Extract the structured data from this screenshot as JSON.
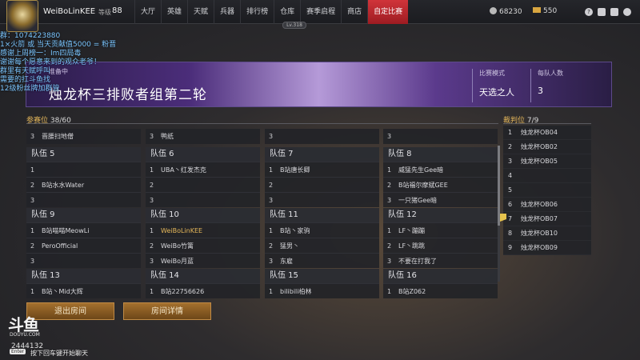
{
  "topbar": {
    "username": "WeiBoLinKEE",
    "level_label": "等级",
    "level_value": "88",
    "nav": [
      "大厅",
      "英雄",
      "天赋",
      "兵器",
      "排行榜",
      "仓库",
      "赛季启程",
      "商店",
      "自定比赛"
    ],
    "active_nav": "自定比赛",
    "coins": "68230",
    "gold": "550",
    "level_tag": "Lv.318"
  },
  "overlay": {
    "lines": [
      "群：1074223880",
      "1×火箭 或 当天贡献值5000 = 粉晋",
      "感谢上周榜一：Im四局毒",
      "谢谢每个愿意来到的观众老爷！",
      "群里有天赋呼叫",
      "需要的扛斗鱼找",
      "12级粉丝牌加群管"
    ]
  },
  "banner": {
    "subtitle": "准备中",
    "title": "烛龙杯三排败者组第二轮",
    "mode_label": "比赛模式",
    "mode_value": "天选之人",
    "size_label": "每队人数",
    "size_value": "3"
  },
  "participants": {
    "label": "参赛位",
    "count": "38/60"
  },
  "referees": {
    "label": "裁判位",
    "count": "7/9",
    "rows": [
      {
        "num": "1",
        "name": "烛龙杯OB04"
      },
      {
        "num": "2",
        "name": "烛龙杯OB02"
      },
      {
        "num": "3",
        "name": "烛龙杯OB05"
      },
      {
        "num": "4",
        "name": ""
      },
      {
        "num": "5",
        "name": ""
      },
      {
        "num": "6",
        "name": "烛龙杯OB06"
      },
      {
        "num": "7",
        "name": "烛龙杯OB07"
      },
      {
        "num": "8",
        "name": "烛龙杯OB10"
      },
      {
        "num": "9",
        "name": "烛龙杯OB09"
      }
    ]
  },
  "partial_row": [
    {
      "num": "3",
      "name": "晋腰扫地僧"
    },
    {
      "num": "3",
      "name": "鸭纸"
    },
    {
      "num": "3",
      "name": ""
    },
    {
      "num": "3",
      "name": ""
    }
  ],
  "teams": [
    {
      "title": "队伍 5",
      "players": [
        {
          "num": "1",
          "name": ""
        },
        {
          "num": "2",
          "name": "B站水水Water"
        },
        {
          "num": "3",
          "name": ""
        }
      ]
    },
    {
      "title": "队伍 6",
      "players": [
        {
          "num": "1",
          "name": "UBA丶红发杰克"
        },
        {
          "num": "2",
          "name": ""
        },
        {
          "num": "3",
          "name": ""
        }
      ]
    },
    {
      "title": "队伍 7",
      "players": [
        {
          "num": "1",
          "name": "B站唐长卿"
        },
        {
          "num": "2",
          "name": ""
        },
        {
          "num": "3",
          "name": ""
        }
      ]
    },
    {
      "title": "队伍 8",
      "players": [
        {
          "num": "1",
          "name": "威猛先生Gee暗"
        },
        {
          "num": "2",
          "name": "B站福尔摩斌GEE"
        },
        {
          "num": "3",
          "name": "一只猪Gee暗"
        }
      ]
    },
    {
      "title": "队伍 9",
      "players": [
        {
          "num": "1",
          "name": "B站喵喵MeowLi"
        },
        {
          "num": "2",
          "name": "PeroOfficial"
        },
        {
          "num": "3",
          "name": ""
        }
      ]
    },
    {
      "title": "队伍 10",
      "players": [
        {
          "num": "1",
          "name": "WeiBoLinKEE"
        },
        {
          "num": "2",
          "name": "WeiBo竹篱"
        },
        {
          "num": "3",
          "name": "WeiBo月蓝"
        }
      ]
    },
    {
      "title": "队伍 11",
      "players": [
        {
          "num": "1",
          "name": "B站丶家驹"
        },
        {
          "num": "2",
          "name": "猛男丶"
        },
        {
          "num": "3",
          "name": "东雇"
        }
      ]
    },
    {
      "title": "队伍 12",
      "players": [
        {
          "num": "1",
          "name": "LF丶蹦蹦"
        },
        {
          "num": "2",
          "name": "LF丶跳跳"
        },
        {
          "num": "3",
          "name": "不要在打我了"
        }
      ]
    },
    {
      "title": "队伍 13",
      "players": [
        {
          "num": "1",
          "name": "B站丶Mid大辉"
        }
      ]
    },
    {
      "title": "队伍 14",
      "players": [
        {
          "num": "1",
          "name": "B站22756626"
        }
      ]
    },
    {
      "title": "队伍 15",
      "players": [
        {
          "num": "1",
          "name": "bilibili柏林"
        }
      ]
    },
    {
      "title": "队伍 16",
      "players": [
        {
          "num": "1",
          "name": "B站Z062"
        }
      ]
    }
  ],
  "buttons": {
    "exit": "退出房间",
    "details": "房间详情"
  },
  "watermark": {
    "logo": "斗鱼",
    "logo_sub": "DOUYU.COM",
    "room_id": "2444132",
    "enter_key": "Enter",
    "chat_hint": "按下回车键开始聊天"
  },
  "colors": {
    "accent_red": "#c8262c",
    "highlight_gold": "#e6b85a",
    "button_bronze": "#8b5a22"
  }
}
